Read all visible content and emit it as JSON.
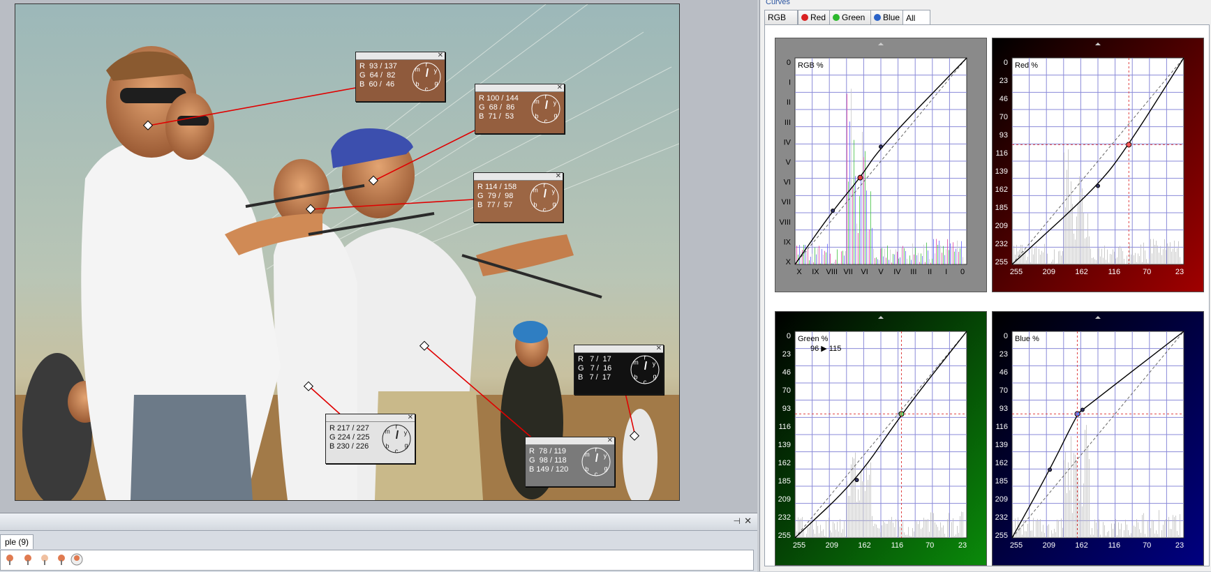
{
  "panel_title": "Curves",
  "tabs": [
    {
      "label": "RGB",
      "icon": "none",
      "active": false
    },
    {
      "label": "Red",
      "icon": "red-dot-icon",
      "color": "#d92020",
      "active": false
    },
    {
      "label": "Green",
      "icon": "green-dot-icon",
      "color": "#2db82d",
      "active": false
    },
    {
      "label": "Blue",
      "icon": "blue-dot-icon",
      "color": "#2a62c8",
      "active": false
    },
    {
      "label": "All",
      "icon": "none",
      "active": true
    }
  ],
  "curves": {
    "rgb": {
      "label": "RGB %",
      "y_ticks": [
        "0",
        "I",
        "II",
        "III",
        "IV",
        "V",
        "VI",
        "VII",
        "VIII",
        "IX",
        "X"
      ],
      "x_ticks": [
        "X",
        "IX",
        "VIII",
        "VII",
        "VI",
        "V",
        "IV",
        "III",
        "II",
        "I",
        "0"
      ],
      "bg": "#6b6b6b"
    },
    "red": {
      "label": "Red %",
      "y_ticks": [
        "0",
        "23",
        "46",
        "70",
        "93",
        "116",
        "139",
        "162",
        "185",
        "209",
        "232",
        "255"
      ],
      "x_ticks": [
        "255",
        "209",
        "162",
        "116",
        "70",
        "23"
      ],
      "bg": "#a00000"
    },
    "green": {
      "label": "Green %",
      "readout": "96 ▶ 115",
      "y_ticks": [
        "0",
        "23",
        "46",
        "70",
        "93",
        "116",
        "139",
        "162",
        "185",
        "209",
        "232",
        "255"
      ],
      "x_ticks": [
        "255",
        "209",
        "162",
        "116",
        "70",
        "23"
      ],
      "bg": "#0a8a0a"
    },
    "blue": {
      "label": "Blue %",
      "y_ticks": [
        "0",
        "23",
        "46",
        "70",
        "93",
        "116",
        "139",
        "162",
        "185",
        "209",
        "232",
        "255"
      ],
      "x_ticks": [
        "255",
        "209",
        "162",
        "116",
        "70",
        "23"
      ],
      "bg": "#000080"
    }
  },
  "samples": [
    {
      "r": "R  93 / 137",
      "g": "G  64 /  82",
      "b": "B  60 /  46",
      "bg": "#8f5a3c"
    },
    {
      "r": "R 100 / 144",
      "g": "G  68 /  86",
      "b": "B  71 /  53",
      "bg": "#955f3f"
    },
    {
      "r": "R 114 / 158",
      "g": "G  79 /  98",
      "b": "B  77 /  57",
      "bg": "#9c6644"
    },
    {
      "r": "R   7 /  17",
      "g": "G   7 /  16",
      "b": "B   7 /  17",
      "bg": "#111111"
    },
    {
      "r": "R 217 / 227",
      "g": "G 224 / 225",
      "b": "B 230 / 226",
      "bg": "#e3e3e3"
    },
    {
      "r": "R  78 / 119",
      "g": "G  98 / 118",
      "b": "B 149 / 120",
      "bg": "#7a7a7a"
    }
  ],
  "dial_letters": [
    "m",
    "r",
    "y",
    "b",
    "c",
    "g"
  ],
  "bottom_tab_label": "ple (9)"
}
